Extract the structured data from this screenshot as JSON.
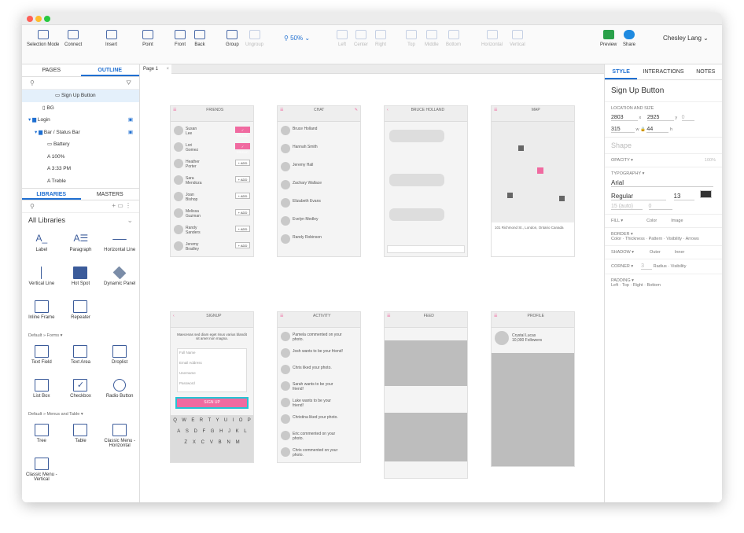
{
  "colors": {
    "accent": "#1f6fd1",
    "pink": "#f06aa0",
    "red": "#fe5f57",
    "yellow": "#febc2e",
    "green": "#28c840"
  },
  "toolbar": {
    "items": [
      "Selection Mode",
      "Connect",
      "Insert",
      "Point",
      "Front",
      "Back",
      "Group",
      "Ungroup",
      "Left",
      "Center",
      "Right",
      "Top",
      "Middle",
      "Bottom",
      "Horizontal",
      "Vertical",
      "Preview",
      "Share"
    ],
    "zoom": "50%",
    "user": "Chesley Lang"
  },
  "left": {
    "tabs": [
      "PAGES",
      "OUTLINE"
    ],
    "outline": [
      "Sign Up Button",
      "BG",
      "Login",
      "Bar / Status Bar",
      "Battery",
      "100%",
      "3:33 PM",
      "Treble"
    ],
    "lib_tabs": [
      "LIBRARIES",
      "MASTERS"
    ],
    "library_select": "All Libraries",
    "widgets": [
      "Label",
      "Paragraph",
      "Horizontal Line",
      "Vertical Line",
      "Hot Spot",
      "Dynamic Panel",
      "Inline Frame",
      "Repeater"
    ],
    "forms_header": "Default » Forms ▾",
    "forms": [
      "Text Field",
      "Text Area",
      "Droplist",
      "List Box",
      "Checkbox",
      "Radio Button"
    ],
    "menus_header": "Default » Menus and Table ▾",
    "menus": [
      "Tree",
      "Table",
      "Classic Menu - Horizontal",
      "Classic Menu - Vertical"
    ]
  },
  "canvas": {
    "page_tab": "Page 1",
    "friends": {
      "title": "FRIENDS",
      "rows": [
        [
          "Susan",
          "Lee"
        ],
        [
          "Lori",
          "Gomez"
        ],
        [
          "Heather",
          "Porter"
        ],
        [
          "Sara",
          "Mendoza"
        ],
        [
          "Joan",
          "Bishop"
        ],
        [
          "Melissa",
          "Guzman"
        ],
        [
          "Randy",
          "Sanders"
        ],
        [
          "Jeremy",
          "Bradley"
        ]
      ],
      "follow": "✓ FRIEND",
      "add": "+ ADD"
    },
    "chat_names": [
      "Bruce Holland",
      "Hannah Smith",
      "Jeremy Hall",
      "Zachary Wallace",
      "Elizabeth Evans",
      "Evelyn Medley",
      "Randy Robinson"
    ],
    "screen_titles": [
      "FRIENDS",
      "CHAT",
      "BRUCE HOLLAND",
      "MAP",
      "SIGNUP",
      "ACTIVITY",
      "FEED",
      "PROFILE"
    ],
    "map_address": "101 Richmond St., London, Ontario Canada",
    "signup": {
      "text": "Maecenas sed diam eget risus varius blandit sit amet non magna.",
      "fields": [
        "Full Name",
        "Email Address",
        "Username",
        "Password"
      ],
      "button": "SIGN UP",
      "keys": [
        "Q",
        "W",
        "E",
        "R",
        "T",
        "Y",
        "U",
        "I",
        "O",
        "P"
      ],
      "keys2": [
        "A",
        "S",
        "D",
        "F",
        "G",
        "H",
        "J",
        "K",
        "L"
      ],
      "keys3": [
        "Z",
        "X",
        "C",
        "V",
        "B",
        "N",
        "M"
      ]
    },
    "activity": [
      "Pamela commented on your photo.",
      "Josh wants to be your friend!",
      "Chris liked your photo.",
      "Sarah wants to be your friend!",
      "Luke wants to be your friend!",
      "Christina liked your photo.",
      "Eric commented on your photo.",
      "Chris commented on your photo."
    ],
    "profile": {
      "name": "Crystal Lucas",
      "followers": "10,000 Followers"
    }
  },
  "right": {
    "tabs": [
      "STYLE",
      "INTERACTIONS",
      "NOTES"
    ],
    "selected": "Sign Up Button",
    "loc_label": "LOCATION AND SIZE",
    "x": "2803",
    "y": "2925",
    "r": "0",
    "w": "315",
    "h": "44",
    "shape": "Shape",
    "opacity_label": "OPACITY ▾",
    "opacity": "100%",
    "typo_label": "TYPOGRAPHY ▾",
    "font": "Arial",
    "weight": "Regular",
    "size": "13",
    "line": "15 (auto)",
    "char": "0",
    "fill_label": "FILL ▾",
    "fill_opts": [
      "Color",
      "Image"
    ],
    "border_label": "BORDER ▾",
    "border_opts": [
      "Color",
      "Thickness",
      "Pattern",
      "Visibility",
      "Arrows"
    ],
    "shadow_label": "SHADOW ▾",
    "shadow_opts": [
      "Outer",
      "Inner"
    ],
    "corner_label": "CORNER ▾",
    "corner": "3",
    "corner_opts": [
      "Radius",
      "Visibility"
    ],
    "padding_label": "PADDING ▾",
    "padding_opts": [
      "Left",
      "Top",
      "Right",
      "Bottom"
    ]
  }
}
